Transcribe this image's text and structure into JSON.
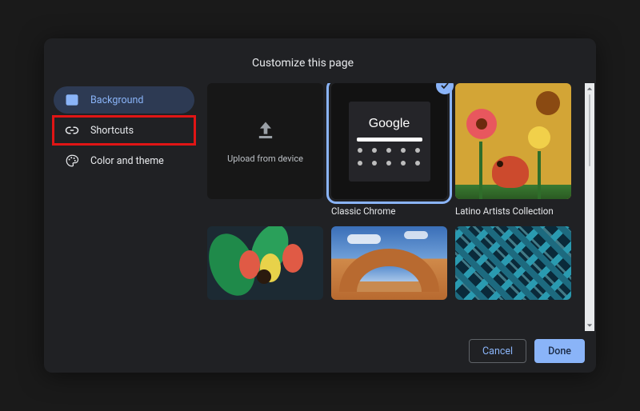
{
  "dialog": {
    "title": "Customize this page"
  },
  "sidebar": {
    "items": [
      {
        "id": "background",
        "label": "Background",
        "icon": "image-icon",
        "selected": true
      },
      {
        "id": "shortcuts",
        "label": "Shortcuts",
        "icon": "link-icon",
        "highlighted": true
      },
      {
        "id": "color-theme",
        "label": "Color and theme",
        "icon": "palette-icon"
      }
    ]
  },
  "backgrounds": {
    "upload_label": "Upload from device",
    "tiles": [
      {
        "id": "upload",
        "type": "upload",
        "label": ""
      },
      {
        "id": "classic",
        "type": "classic",
        "label": "Classic Chrome",
        "selected": true,
        "preview_text": "Google"
      },
      {
        "id": "latino",
        "type": "collection",
        "label": "Latino Artists Collection"
      },
      {
        "id": "flowers",
        "type": "collection",
        "label": ""
      },
      {
        "id": "arch",
        "type": "collection",
        "label": ""
      },
      {
        "id": "geometric",
        "type": "collection",
        "label": ""
      }
    ]
  },
  "footer": {
    "cancel": "Cancel",
    "done": "Done"
  },
  "colors": {
    "accent": "#8ab4f8",
    "highlight_box": "#e01515",
    "dialog_bg": "#202124"
  }
}
